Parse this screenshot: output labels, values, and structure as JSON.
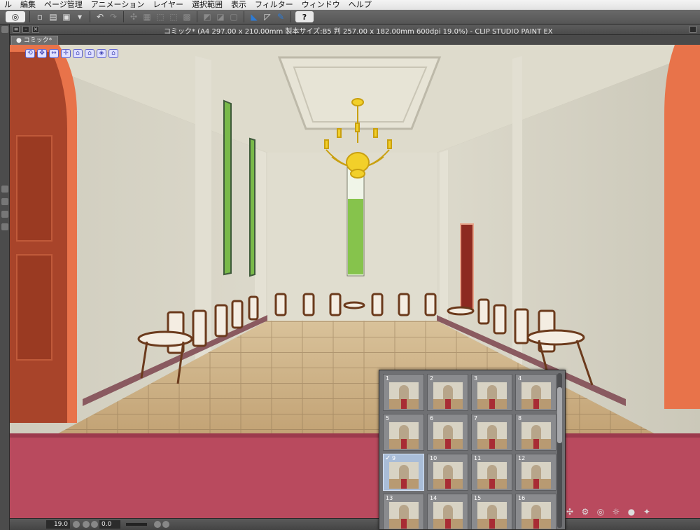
{
  "menu": {
    "items": [
      "ル",
      "編集",
      "ページ管理",
      "アニメーション",
      "レイヤー",
      "選択範囲",
      "表示",
      "フィルター",
      "ウィンドウ",
      "ヘルプ"
    ]
  },
  "toolbar": {
    "icons": [
      "clip-studio-icon",
      "new-icon",
      "open-icon",
      "save-icon",
      "undo-icon",
      "redo-icon",
      "transform-icon",
      "snap-icon",
      "pen-icon",
      "ruler-icon",
      "help-icon"
    ],
    "help_label": "?"
  },
  "window": {
    "title": "コミック* (A4 297.00 x 210.00mm 製本サイズ:B5 判 257.00 x 182.00mm 600dpi 19.0%)  - CLIP STUDIO PAINT EX",
    "tab_label": "コミック*"
  },
  "status": {
    "zoom": "19.0",
    "angle": "0.0"
  },
  "scene_presets": {
    "selected": "9",
    "items": [
      {
        "num": "1",
        "selected": false
      },
      {
        "num": "2",
        "selected": false
      },
      {
        "num": "3",
        "selected": false
      },
      {
        "num": "4",
        "selected": false
      },
      {
        "num": "5",
        "selected": false
      },
      {
        "num": "6",
        "selected": false
      },
      {
        "num": "7",
        "selected": false
      },
      {
        "num": "8",
        "selected": false
      },
      {
        "num": "9",
        "selected": true
      },
      {
        "num": "10",
        "selected": false
      },
      {
        "num": "11",
        "selected": false
      },
      {
        "num": "12",
        "selected": false
      },
      {
        "num": "13",
        "selected": false
      },
      {
        "num": "14",
        "selected": false
      },
      {
        "num": "15",
        "selected": false
      },
      {
        "num": "16",
        "selected": false
      }
    ]
  },
  "colors": {
    "wall": "#d5d2c3",
    "floor": "#c8ab7c",
    "carpet": "#b24a5c",
    "door": "#e8734a",
    "chandelier": "#e8c21a",
    "window_glass": "#7fbf4a"
  }
}
